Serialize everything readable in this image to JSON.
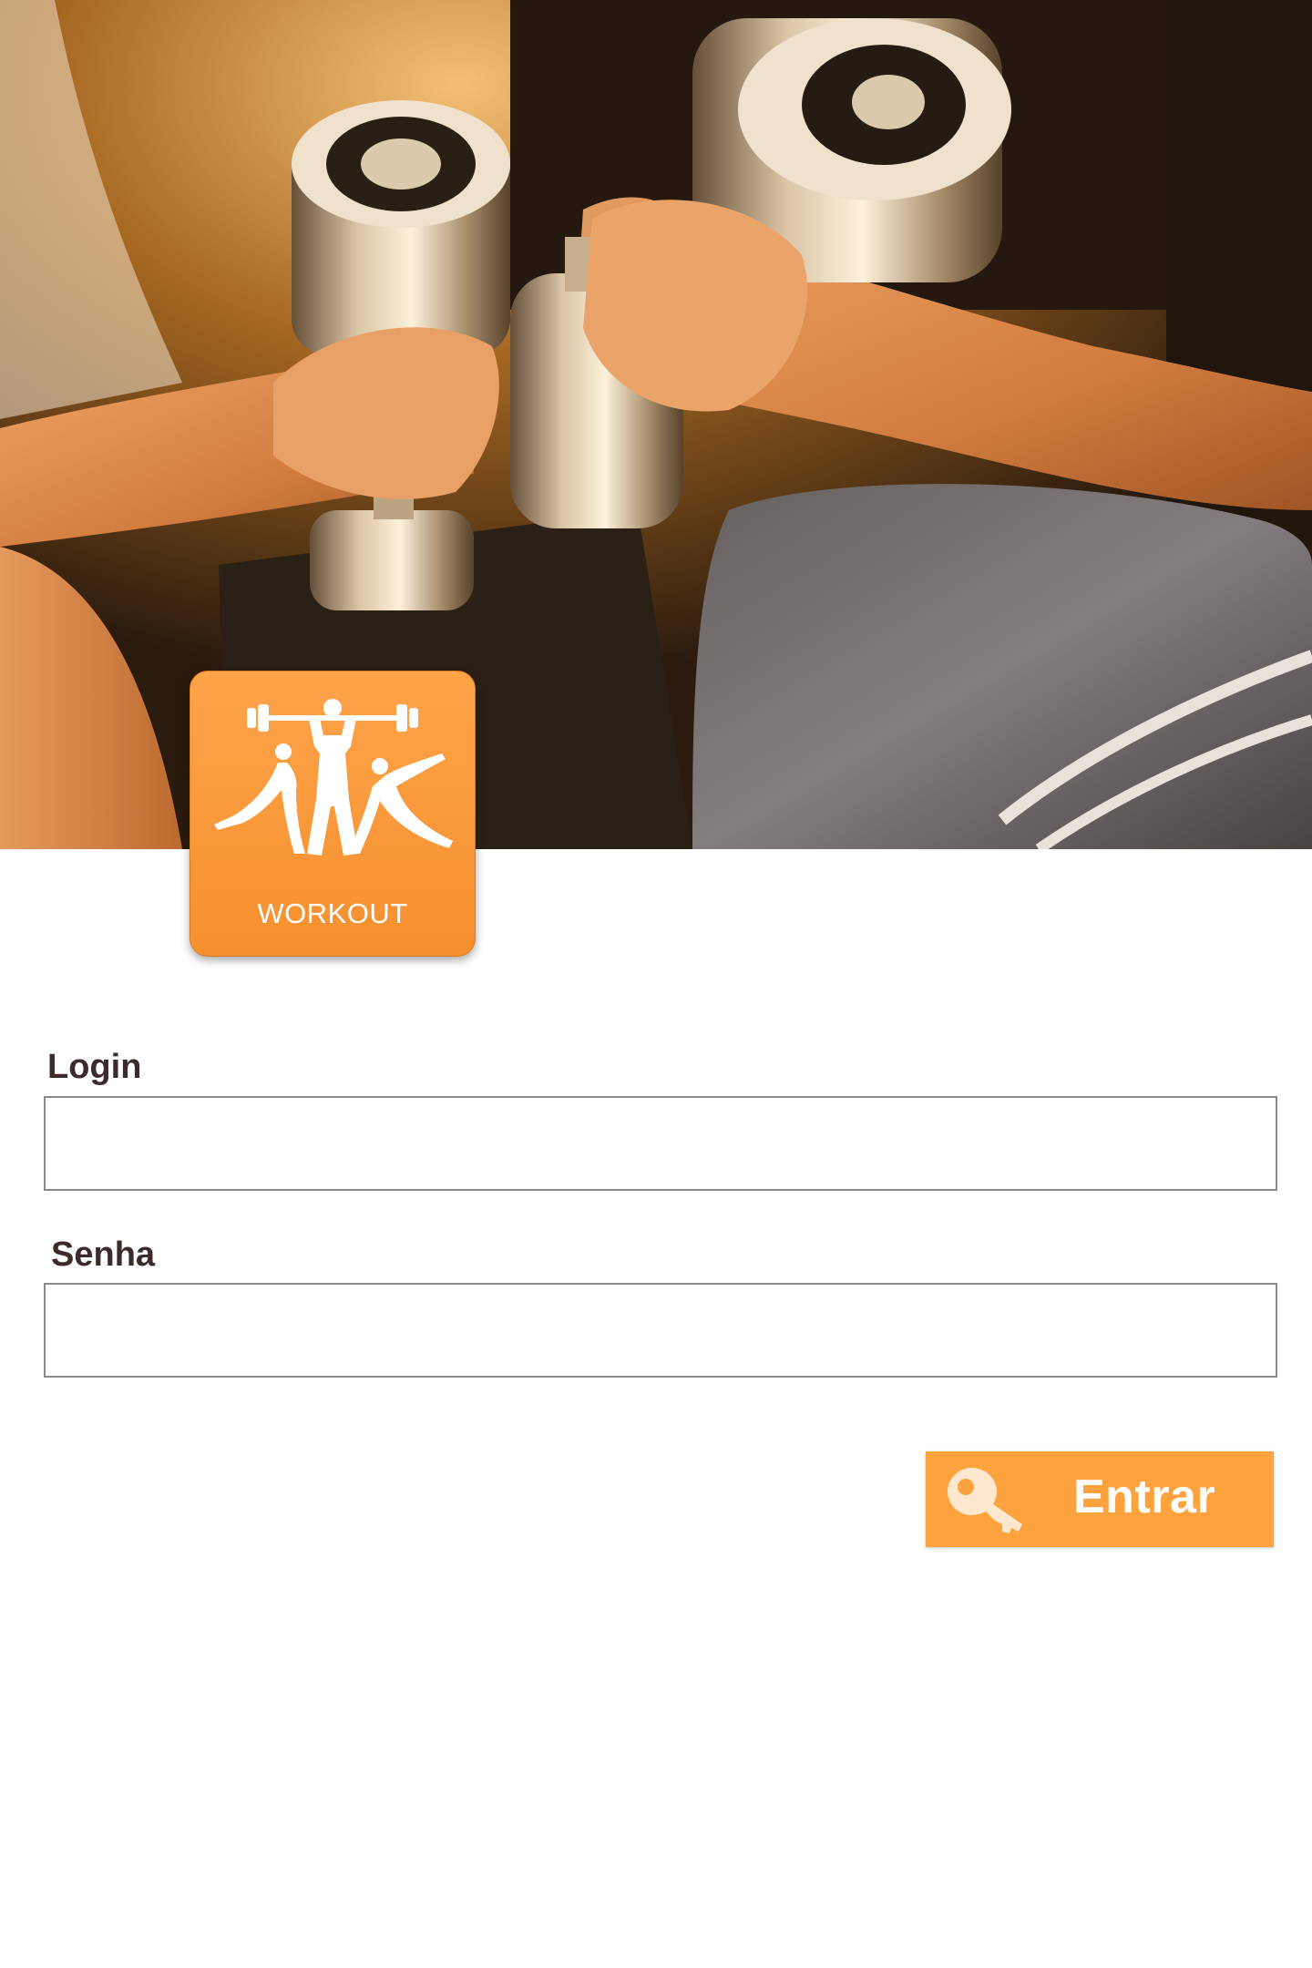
{
  "hero": {
    "image": "gym-dumbbells-photo"
  },
  "logo": {
    "text": "WORKOUT",
    "icon": "athletes-silhouette-icon",
    "color": "#f6902e"
  },
  "form": {
    "login_label": "Login",
    "login_value": "",
    "password_label": "Senha",
    "password_value": "",
    "submit_label": "Entrar",
    "submit_icon": "key-icon",
    "accent_color": "#fda33e"
  }
}
